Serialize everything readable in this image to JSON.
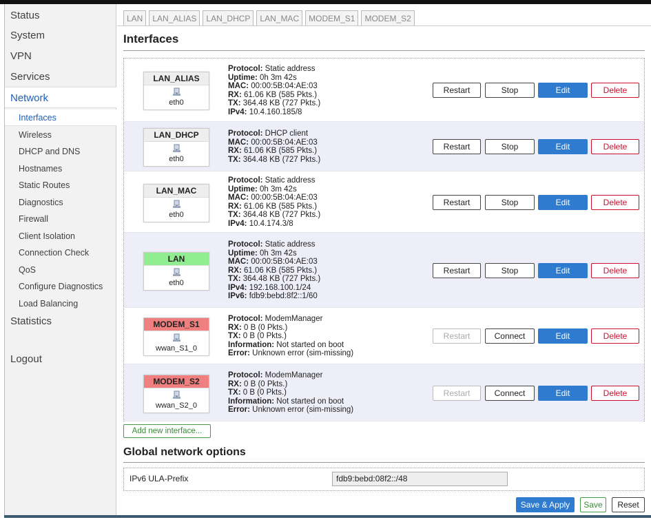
{
  "sidebar": {
    "items": [
      "Status",
      "System",
      "VPN",
      "Services",
      "Network"
    ],
    "network_sub": [
      "Interfaces",
      "Wireless",
      "DHCP and DNS",
      "Hostnames",
      "Static Routes",
      "Diagnostics",
      "Firewall",
      "Client Isolation",
      "Connection Check",
      "QoS",
      "Configure Diagnostics",
      "Load Balancing"
    ],
    "after": [
      "Statistics",
      "Logout"
    ]
  },
  "tabs": [
    "LAN",
    "LAN_ALIAS",
    "LAN_DHCP",
    "LAN_MAC",
    "MODEM_S1",
    "MODEM_S2"
  ],
  "page_title": "Interfaces",
  "buttons": {
    "restart": "Restart",
    "stop": "Stop",
    "connect": "Connect",
    "edit": "Edit",
    "delete": "Delete"
  },
  "colors": {
    "lan_badge": "#90ee90",
    "modem_badge": "#f08080",
    "default_badge": "#eeeeee",
    "accent": "#2e7bcf",
    "danger": "#c8102e"
  },
  "interfaces": [
    {
      "name": "LAN_ALIAS",
      "device": "eth0",
      "badge_color": "default",
      "lines": [
        [
          "Protocol:",
          " Static address"
        ],
        [
          "Uptime:",
          " 0h 3m 42s"
        ],
        [
          "MAC:",
          " 00:00:5B:04:AE:03"
        ],
        [
          "RX:",
          " 61.06 KB (585 Pkts.)"
        ],
        [
          "TX:",
          " 364.48 KB (727 Pkts.)"
        ],
        [
          "IPv4:",
          " 10.4.160.185/8"
        ]
      ],
      "second_button": "Stop",
      "restart_disabled": false
    },
    {
      "name": "LAN_DHCP",
      "device": "eth0",
      "badge_color": "default",
      "lines": [
        [
          "Protocol:",
          " DHCP client"
        ],
        [
          "MAC:",
          " 00:00:5B:04:AE:03"
        ],
        [
          "RX:",
          " 61.06 KB (585 Pkts.)"
        ],
        [
          "TX:",
          " 364.48 KB (727 Pkts.)"
        ]
      ],
      "second_button": "Stop",
      "restart_disabled": false
    },
    {
      "name": "LAN_MAC",
      "device": "eth0",
      "badge_color": "default",
      "lines": [
        [
          "Protocol:",
          " Static address"
        ],
        [
          "Uptime:",
          " 0h 3m 42s"
        ],
        [
          "MAC:",
          " 00:00:5B:04:AE:03"
        ],
        [
          "RX:",
          " 61.06 KB (585 Pkts.)"
        ],
        [
          "TX:",
          " 364.48 KB (727 Pkts.)"
        ],
        [
          "IPv4:",
          " 10.4.174.3/8"
        ]
      ],
      "second_button": "Stop",
      "restart_disabled": false
    },
    {
      "name": "LAN",
      "device": "eth0",
      "badge_color": "lan",
      "lines": [
        [
          "Protocol:",
          " Static address"
        ],
        [
          "Uptime:",
          " 0h 3m 42s"
        ],
        [
          "MAC:",
          " 00:00:5B:04:AE:03"
        ],
        [
          "RX:",
          " 61.06 KB (585 Pkts.)"
        ],
        [
          "TX:",
          " 364.48 KB (727 Pkts.)"
        ],
        [
          "IPv4:",
          " 192.168.100.1/24"
        ],
        [
          "IPv6:",
          " fdb9:bebd:8f2::1/60"
        ]
      ],
      "second_button": "Stop",
      "restart_disabled": false
    },
    {
      "name": "MODEM_S1",
      "device": "wwan_S1_0",
      "badge_color": "modem",
      "lines": [
        [
          "Protocol:",
          " ModemManager"
        ],
        [
          "RX:",
          " 0 B (0 Pkts.)"
        ],
        [
          "TX:",
          " 0 B (0 Pkts.)"
        ],
        [
          "Information:",
          " Not started on boot"
        ],
        [
          "Error:",
          " Unknown error (sim-missing)"
        ]
      ],
      "second_button": "Connect",
      "restart_disabled": true
    },
    {
      "name": "MODEM_S2",
      "device": "wwan_S2_0",
      "badge_color": "modem",
      "lines": [
        [
          "Protocol:",
          " ModemManager"
        ],
        [
          "RX:",
          " 0 B (0 Pkts.)"
        ],
        [
          "TX:",
          " 0 B (0 Pkts.)"
        ],
        [
          "Information:",
          " Not started on boot"
        ],
        [
          "Error:",
          " Unknown error (sim-missing)"
        ]
      ],
      "second_button": "Connect",
      "restart_disabled": true
    }
  ],
  "add_interface": "Add new interface...",
  "global_title": "Global network options",
  "ula": {
    "label": "IPv6 ULA-Prefix",
    "value": "fdb9:bebd:08f2::/48"
  },
  "footer": {
    "save_apply": "Save & Apply",
    "save": "Save",
    "reset": "Reset"
  }
}
